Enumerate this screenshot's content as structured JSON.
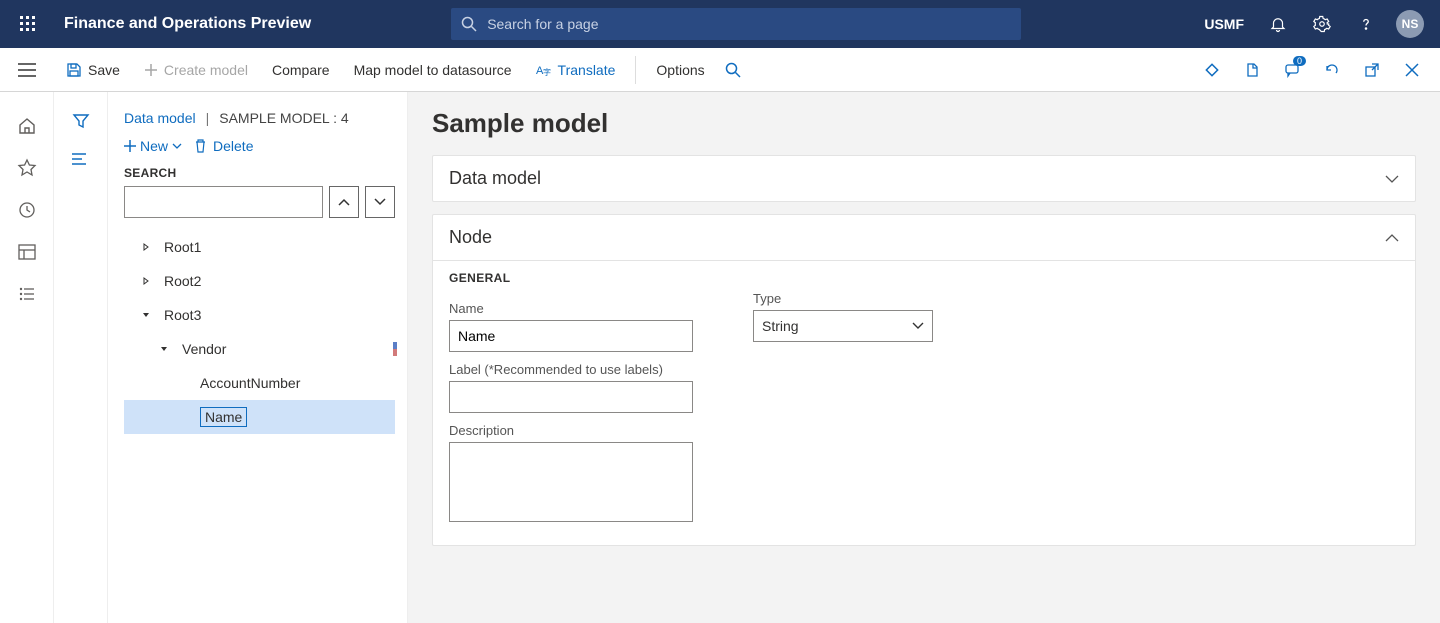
{
  "header": {
    "app_title": "Finance and Operations Preview",
    "search_placeholder": "Search for a page",
    "legal_entity": "USMF",
    "avatar_initials": "NS"
  },
  "cmdbar": {
    "save": "Save",
    "create_model": "Create model",
    "compare": "Compare",
    "map_model": "Map model to datasource",
    "translate": "Translate",
    "options": "Options",
    "badge_count": "0"
  },
  "breadcrumb": {
    "root": "Data model",
    "current": "SAMPLE MODEL : 4"
  },
  "tree_toolbar": {
    "new_label": "New",
    "delete_label": "Delete"
  },
  "search_panel": {
    "label": "SEARCH"
  },
  "tree": {
    "nodes": [
      {
        "label": "Root1",
        "level": 0,
        "expanded": false,
        "hasChildren": true,
        "selected": false
      },
      {
        "label": "Root2",
        "level": 0,
        "expanded": false,
        "hasChildren": true,
        "selected": false
      },
      {
        "label": "Root3",
        "level": 0,
        "expanded": true,
        "hasChildren": true,
        "selected": false
      },
      {
        "label": "Vendor",
        "level": 1,
        "expanded": true,
        "hasChildren": true,
        "selected": false,
        "accent": true
      },
      {
        "label": "AccountNumber",
        "level": 2,
        "expanded": false,
        "hasChildren": false,
        "selected": false
      },
      {
        "label": "Name",
        "level": 2,
        "expanded": false,
        "hasChildren": false,
        "selected": true
      }
    ]
  },
  "main": {
    "title": "Sample model",
    "card1_title": "Data model",
    "card2_title": "Node",
    "section_general": "GENERAL",
    "fld_name_label": "Name",
    "fld_name_value": "Name",
    "fld_label_label": "Label (*Recommended to use labels)",
    "fld_label_value": "",
    "fld_desc_label": "Description",
    "fld_desc_value": "",
    "fld_type_label": "Type",
    "fld_type_value": "String"
  }
}
